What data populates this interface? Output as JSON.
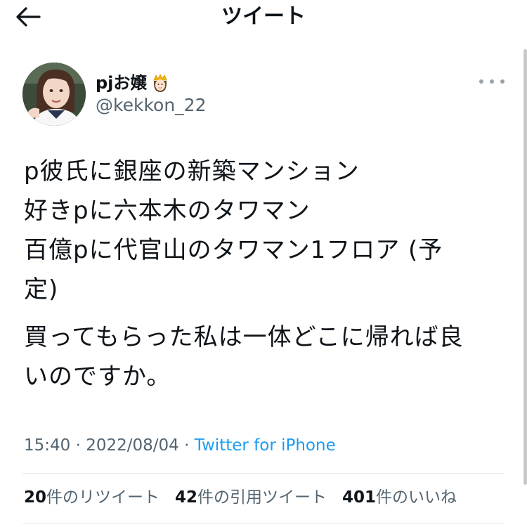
{
  "header": {
    "title": "ツイート"
  },
  "user": {
    "display_name": "pjお嬢",
    "name_emoji": "princess-emoji",
    "handle": "@kekkon_22"
  },
  "tweet": {
    "paragraphs": [
      "p彼氏に銀座の新築マンション\n好きpに六本木のタワマン\n百億pに代官山のタワマン1フロア (予\n定)",
      "買ってもらった私は一体どこに帰れば良\nいのですか。"
    ]
  },
  "meta": {
    "time": "15:40",
    "separator1": " · ",
    "date": "2022/08/04",
    "separator2": " · ",
    "source": "Twitter for iPhone"
  },
  "stats": {
    "retweets": {
      "count": "20",
      "label": "件のリツイート"
    },
    "quotes": {
      "count": "42",
      "label": "件の引用ツイート"
    },
    "likes": {
      "count": "401",
      "label": "件のいいね"
    }
  },
  "colors": {
    "accent": "#1d9bf0",
    "secondary_text": "#536471",
    "primary_text": "#0f1419"
  }
}
